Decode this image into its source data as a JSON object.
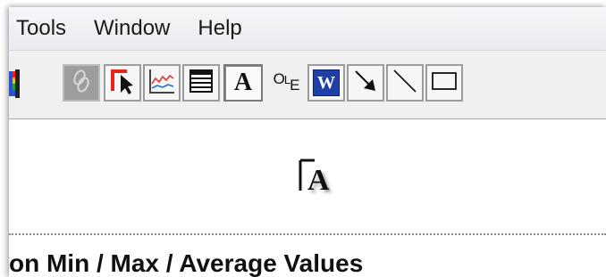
{
  "menubar": {
    "items": [
      "Tools",
      "Window",
      "Help"
    ]
  },
  "toolbar": {
    "buttons": [
      {
        "name": "color-bars-icon"
      },
      {
        "name": "link-icon",
        "state": "disabled"
      },
      {
        "name": "select-pointer-icon"
      },
      {
        "name": "chart-icon"
      },
      {
        "name": "table-icon"
      },
      {
        "name": "text-tool-icon",
        "glyph": "A",
        "state": "pressed"
      },
      {
        "name": "ole-object-icon",
        "label_parts": [
          "O",
          "L",
          "E"
        ]
      },
      {
        "name": "word-document-icon",
        "glyph": "W"
      },
      {
        "name": "arrow-line-icon"
      },
      {
        "name": "line-icon"
      },
      {
        "name": "rectangle-icon"
      }
    ]
  },
  "canvas": {
    "cursor_glyph": "A",
    "heading": "on Min / Max / Average Values"
  },
  "colors": {
    "pointer_red": "#e8241c",
    "word_blue": "#1f3fa8",
    "chart_red": "#e23a2e",
    "chart_blue": "#2a6fd6"
  }
}
